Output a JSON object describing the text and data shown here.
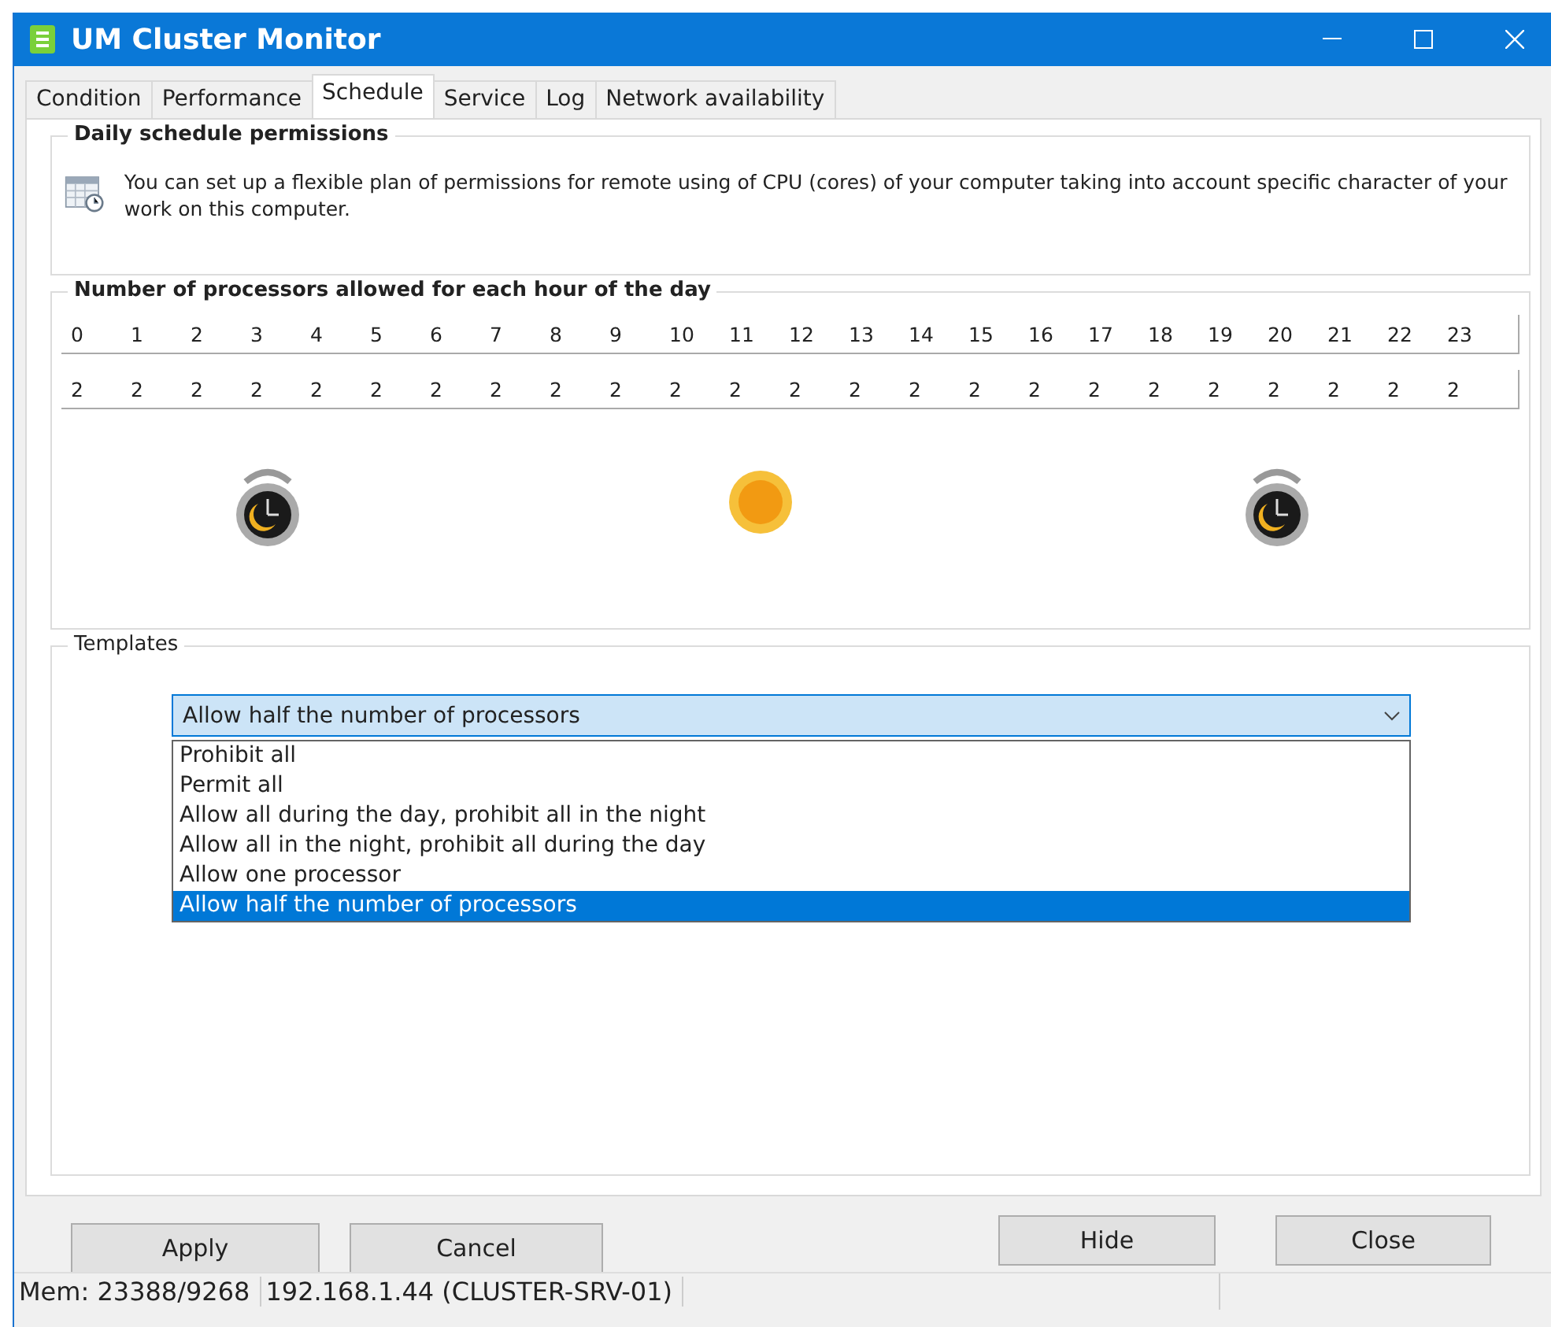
{
  "window": {
    "title": "UM Cluster Monitor"
  },
  "tabs": [
    {
      "label": "Condition",
      "selected": false
    },
    {
      "label": "Performance",
      "selected": false
    },
    {
      "label": "Schedule",
      "selected": true
    },
    {
      "label": "Service",
      "selected": false
    },
    {
      "label": "Log",
      "selected": false
    },
    {
      "label": "Network availability",
      "selected": false
    }
  ],
  "permissions": {
    "title": "Daily schedule permissions",
    "description": "You can set up a flexible plan of permissions for remote using of CPU (cores) of your computer taking into account specific character of your work on this computer."
  },
  "processors": {
    "title": "Number of processors allowed for each hour of the day",
    "hours": [
      "0",
      "1",
      "2",
      "3",
      "4",
      "5",
      "6",
      "7",
      "8",
      "9",
      "10",
      "11",
      "12",
      "13",
      "14",
      "15",
      "16",
      "17",
      "18",
      "19",
      "20",
      "21",
      "22",
      "23"
    ],
    "counts": [
      "2",
      "2",
      "2",
      "2",
      "2",
      "2",
      "2",
      "2",
      "2",
      "2",
      "2",
      "2",
      "2",
      "2",
      "2",
      "2",
      "2",
      "2",
      "2",
      "2",
      "2",
      "2",
      "2",
      "2"
    ]
  },
  "templates": {
    "title": "Templates",
    "value": "Allow half the number of processors",
    "expanded": true,
    "options": [
      {
        "label": "Prohibit all",
        "selected": false
      },
      {
        "label": "Permit all",
        "selected": false
      },
      {
        "label": "Allow all during the day, prohibit all in the night",
        "selected": false
      },
      {
        "label": "Allow all in the night, prohibit all during the day",
        "selected": false
      },
      {
        "label": "Allow one processor",
        "selected": false
      },
      {
        "label": "Allow half the number of processors",
        "selected": true
      }
    ]
  },
  "buttons_left": [
    "Apply",
    "Cancel"
  ],
  "buttons_right": [
    "Hide",
    "Close"
  ],
  "status_bar": [
    "Mem: 23388/9268",
    "192.168.1.44 (CLUSTER-SRV-01)"
  ]
}
